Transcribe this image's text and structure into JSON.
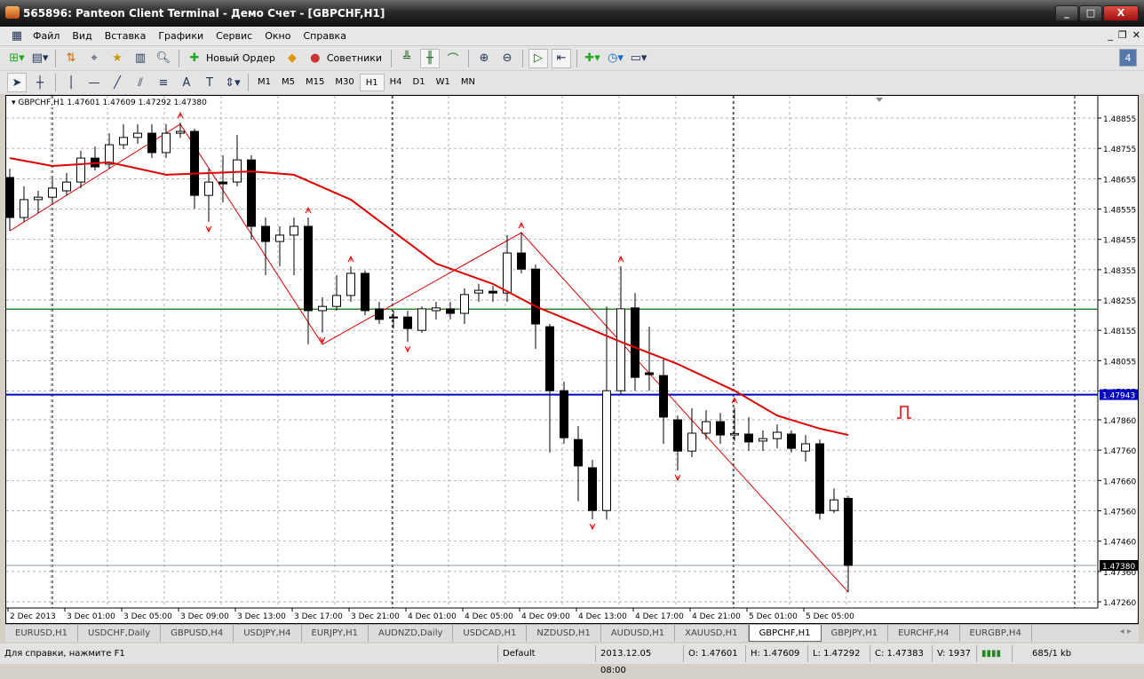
{
  "window": {
    "title": "565896: Panteon Client Terminal - Демо Счет - [GBPCHF,H1]"
  },
  "menu": [
    "Файл",
    "Вид",
    "Вставка",
    "Графики",
    "Сервис",
    "Окно",
    "Справка"
  ],
  "toolbar": {
    "new_order": "Новый Ордер",
    "experts": "Советники",
    "notification_count": "4"
  },
  "timeframes": [
    "M1",
    "M5",
    "M15",
    "M30",
    "H1",
    "H4",
    "D1",
    "W1",
    "MN"
  ],
  "active_timeframe": "H1",
  "chart_data": {
    "type": "candlestick",
    "symbol_info": "GBPCHF,H1  1.47601 1.47609 1.47292 1.47380",
    "colors": {
      "bull": "#ffffff",
      "bear": "#000000",
      "ma": "#e00000",
      "zigzag": "#e00000",
      "grid": "#8a98a8",
      "support": "#007000",
      "resistance": "#0000c0"
    },
    "grid": true,
    "ylim": [
      1.4722,
      1.4893
    ],
    "y_ticks": [
      "1.48855",
      "1.48755",
      "1.48655",
      "1.48555",
      "1.48455",
      "1.48355",
      "1.48255",
      "1.48155",
      "1.48055",
      "1.47955",
      "1.47860",
      "1.47760",
      "1.47660",
      "1.47560",
      "1.47460",
      "1.47360",
      "1.47260"
    ],
    "x_labels": [
      "2 Dec 2013",
      "3 Dec 01:00",
      "3 Dec 05:00",
      "3 Dec 09:00",
      "3 Dec 13:00",
      "3 Dec 17:00",
      "3 Dec 21:00",
      "4 Dec 01:00",
      "4 Dec 05:00",
      "4 Dec 09:00",
      "4 Dec 13:00",
      "4 Dec 17:00",
      "4 Dec 21:00",
      "5 Dec 01:00",
      "5 Dec 05:00"
    ],
    "candles": [
      [
        1.48659,
        1.48527,
        1.48688,
        1.48483
      ],
      [
        1.48527,
        1.48586,
        1.4863,
        1.48513
      ],
      [
        1.48586,
        1.48594,
        1.48615,
        1.48542
      ],
      [
        1.48594,
        1.48624,
        1.48659,
        1.48577
      ],
      [
        1.48615,
        1.48644,
        1.48674,
        1.486
      ],
      [
        1.48644,
        1.48723,
        1.48747,
        1.48624
      ],
      [
        1.48723,
        1.48694,
        1.48761,
        1.48682
      ],
      [
        1.48703,
        1.48767,
        1.48805,
        1.48688
      ],
      [
        1.48767,
        1.48791,
        1.48835,
        1.48753
      ],
      [
        1.48791,
        1.48805,
        1.48835,
        1.4877
      ],
      [
        1.48805,
        1.48741,
        1.48835,
        1.48723
      ],
      [
        1.48741,
        1.48805,
        1.48835,
        1.48723
      ],
      [
        1.48805,
        1.48811,
        1.4884,
        1.4879
      ],
      [
        1.48811,
        1.486,
        1.4882,
        1.48556
      ],
      [
        1.486,
        1.48644,
        1.48688,
        1.48513
      ],
      [
        1.48644,
        1.48638,
        1.48732,
        1.48577
      ],
      [
        1.48644,
        1.48717,
        1.48799,
        1.4863
      ],
      [
        1.48717,
        1.48498,
        1.48732,
        1.48454
      ],
      [
        1.48498,
        1.48448,
        1.48527,
        1.48337
      ],
      [
        1.48448,
        1.48469,
        1.48498,
        1.48366
      ],
      [
        1.48469,
        1.48498,
        1.48527,
        1.48337
      ],
      [
        1.48498,
        1.4822,
        1.48527,
        1.48109
      ],
      [
        1.4822,
        1.48234,
        1.48264,
        1.48147
      ],
      [
        1.48234,
        1.4827,
        1.48337,
        1.4822
      ],
      [
        1.4827,
        1.48343,
        1.48366,
        1.48249
      ],
      [
        1.48343,
        1.4822,
        1.48352,
        1.48205
      ],
      [
        1.48226,
        1.48191,
        1.48249,
        1.48176
      ],
      [
        1.48199,
        1.48196,
        1.4822,
        1.48161
      ],
      [
        1.48199,
        1.48161,
        1.4822,
        1.48117
      ],
      [
        1.48155,
        1.48226,
        1.48234,
        1.48147
      ],
      [
        1.4822,
        1.48229,
        1.48249,
        1.48191
      ],
      [
        1.48226,
        1.48211,
        1.48249,
        1.48191
      ],
      [
        1.48211,
        1.48273,
        1.48293,
        1.48176
      ],
      [
        1.48278,
        1.48287,
        1.48308,
        1.48249
      ],
      [
        1.48284,
        1.48278,
        1.48302,
        1.48249
      ],
      [
        1.48278,
        1.4841,
        1.48469,
        1.48249
      ],
      [
        1.4841,
        1.48357,
        1.48477,
        1.48343
      ],
      [
        1.48357,
        1.48176,
        1.48372,
        1.48094
      ],
      [
        1.48167,
        1.47956,
        1.48176,
        1.47752
      ],
      [
        1.47956,
        1.47801,
        1.47986,
        1.47781
      ],
      [
        1.47795,
        1.47708,
        1.47839,
        1.47591
      ],
      [
        1.47702,
        1.47561,
        1.47728,
        1.47532
      ],
      [
        1.47561,
        1.47956,
        1.48234,
        1.47532
      ],
      [
        1.47956,
        1.48226,
        1.48366,
        1.47942
      ],
      [
        1.48229,
        1.48,
        1.48278,
        1.47956
      ],
      [
        1.48015,
        1.48009,
        1.48167,
        1.47956
      ],
      [
        1.48006,
        1.47869,
        1.48059,
        1.47781
      ],
      [
        1.4786,
        1.47757,
        1.47874,
        1.47693
      ],
      [
        1.47757,
        1.47816,
        1.47898,
        1.47737
      ],
      [
        1.47816,
        1.47854,
        1.47892,
        1.47795
      ],
      [
        1.47854,
        1.4781,
        1.47883,
        1.47781
      ],
      [
        1.4781,
        1.47815,
        1.479,
        1.4779
      ],
      [
        1.47813,
        1.47787,
        1.47869,
        1.47757
      ],
      [
        1.4779,
        1.47798,
        1.47825,
        1.47757
      ],
      [
        1.47798,
        1.47819,
        1.47845,
        1.47766
      ],
      [
        1.47813,
        1.47766,
        1.47825,
        1.47752
      ],
      [
        1.47757,
        1.47781,
        1.4781,
        1.47722
      ],
      [
        1.47781,
        1.47552,
        1.47795,
        1.47532
      ],
      [
        1.47561,
        1.47596,
        1.47634,
        1.47552
      ],
      [
        1.47601,
        1.4738,
        1.47609,
        1.47292
      ]
    ],
    "moving_average": [
      [
        0,
        1.48723
      ],
      [
        3,
        1.48697
      ],
      [
        7,
        1.48709
      ],
      [
        11,
        1.48668
      ],
      [
        17,
        1.48679
      ],
      [
        20,
        1.48668
      ],
      [
        24,
        1.48586
      ],
      [
        30,
        1.48375
      ],
      [
        34,
        1.48308
      ],
      [
        37,
        1.48234
      ],
      [
        40,
        1.48176
      ],
      [
        43,
        1.48117
      ],
      [
        47,
        1.48044
      ],
      [
        51,
        1.47956
      ],
      [
        54,
        1.47874
      ],
      [
        57,
        1.47831
      ],
      [
        59,
        1.4781
      ]
    ],
    "zigzag": [
      [
        0,
        1.48483
      ],
      [
        12,
        1.48835
      ],
      [
        22,
        1.48109
      ],
      [
        36,
        1.48477
      ],
      [
        59,
        1.47292
      ]
    ],
    "fractals_up": [
      12,
      21,
      24,
      36,
      43,
      51
    ],
    "fractals_down": [
      14,
      22,
      28,
      41,
      47
    ],
    "hlines": {
      "support": 1.48225,
      "resistance": 1.47943,
      "bid": 1.4738
    },
    "labels": {
      "resistance": "1.47943",
      "bid": "1.47380"
    }
  },
  "tabs": [
    "EURUSD,H1",
    "USDCHF,Daily",
    "GBPUSD,H4",
    "USDJPY,H4",
    "EURJPY,H1",
    "AUDNZD,Daily",
    "USDCAD,H1",
    "NZDUSD,H1",
    "AUDUSD,H1",
    "XAUUSD,H1",
    "GBPCHF,H1",
    "GBPJPY,H1",
    "EURCHF,H4",
    "EURGBP,H4"
  ],
  "active_tab": "GBPCHF,H1",
  "status": {
    "help": "Для справки, нажмите F1",
    "profile": "Default",
    "time": "2013.12.05 08:00",
    "open": "O: 1.47601",
    "high": "H: 1.47609",
    "low": "L: 1.47292",
    "close": "C: 1.47383",
    "volume": "V: 1937",
    "traffic": "685/1 kb"
  }
}
